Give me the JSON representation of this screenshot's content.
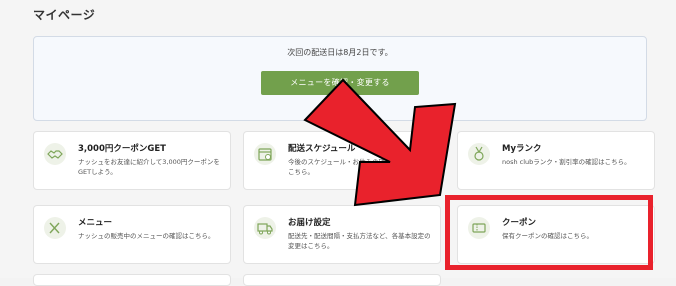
{
  "page": {
    "title": "マイページ"
  },
  "delivery": {
    "notice": "次回の配送日は8月2日です。",
    "button_label": "メニューを確認・変更する"
  },
  "cards": [
    {
      "title": "3,000円クーポンGET",
      "desc": "ナッシュをお友達に紹介して3,000円クーポンをGETしよう。",
      "icon": "handshake-icon"
    },
    {
      "title": "配送スケジュール",
      "desc": "今後のスケジュール・お休みの確認、スキップはこちら。",
      "icon": "calendar-icon"
    },
    {
      "title": "Myランク",
      "desc": "nosh clubランク・割引率の確認はこちら。",
      "icon": "medal-icon"
    },
    {
      "title": "メニュー",
      "desc": "ナッシュの販売中のメニューの確認はこちら。",
      "icon": "utensils-icon"
    },
    {
      "title": "お届け設定",
      "desc": "配送先・配送間隔・支払方法など、各基本設定の変更はこちら。",
      "icon": "truck-icon"
    },
    {
      "title": "クーポン",
      "desc": "保有クーポンの確認はこちら。",
      "icon": "coupon-icon"
    }
  ],
  "colors": {
    "accent": "#72a04c",
    "highlight": "#e9222c"
  }
}
